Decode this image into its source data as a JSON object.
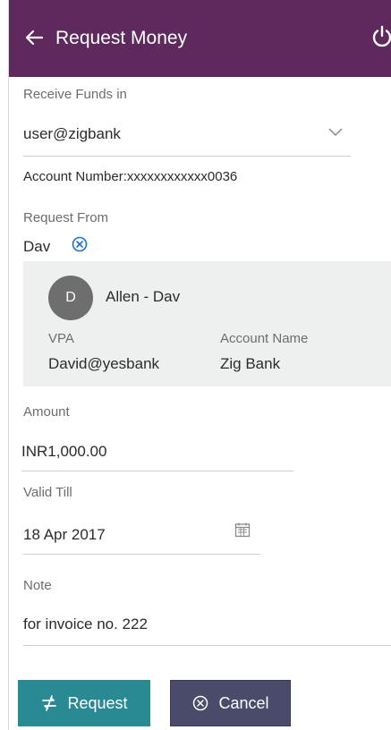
{
  "header": {
    "title": "Request Money",
    "back_icon": "arrow-left-icon",
    "power_icon": "power-icon"
  },
  "receive_funds": {
    "label": "Receive Funds in",
    "selected": "user@zigbank",
    "account_number": "Account Number:xxxxxxxxxxxx0036"
  },
  "request_from": {
    "label": "Request From",
    "chip": "Dav"
  },
  "contact_card": {
    "initial": "D",
    "name": "Allen - Dav",
    "vpa_label": "VPA",
    "vpa_value": "David@yesbank",
    "account_name_label": "Account Name",
    "account_name_value": "Zig Bank"
  },
  "amount": {
    "label": "Amount",
    "value": "INR1,000.00"
  },
  "valid_till": {
    "label": "Valid Till",
    "value": "18 Apr 2017"
  },
  "note": {
    "label": "Note",
    "value": "for invoice no. 222"
  },
  "buttons": {
    "request": "Request",
    "cancel": "Cancel"
  },
  "colors": {
    "header_bg": "#5e2a5e",
    "request_btn": "#2a8a93",
    "cancel_btn": "#4a4a6a",
    "card_bg": "#eef0ef",
    "chip_icon": "#1a6fd1"
  }
}
